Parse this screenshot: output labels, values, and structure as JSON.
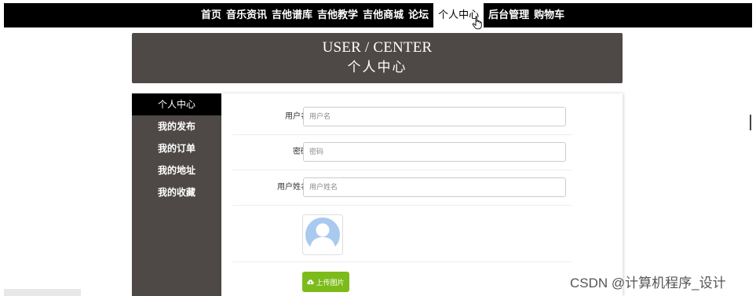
{
  "nav": {
    "items": [
      {
        "label": "首页"
      },
      {
        "label": "音乐资讯"
      },
      {
        "label": "吉他谱库"
      },
      {
        "label": "吉他教学"
      },
      {
        "label": "吉他商城"
      },
      {
        "label": "论坛"
      },
      {
        "label": "个人中心",
        "active": true
      },
      {
        "label": "后台管理"
      },
      {
        "label": "购物车"
      }
    ]
  },
  "banner": {
    "title_en": "USER / CENTER",
    "title_cn": "个人中心"
  },
  "sidebar": {
    "items": [
      {
        "label": "个人中心",
        "active": true
      },
      {
        "label": "我的发布"
      },
      {
        "label": "我的订单"
      },
      {
        "label": "我的地址"
      },
      {
        "label": "我的收藏"
      }
    ]
  },
  "form": {
    "username": {
      "label": "用户名",
      "placeholder": "用户名",
      "value": ""
    },
    "password": {
      "label": "密码",
      "placeholder": "密码",
      "value": ""
    },
    "fullname": {
      "label": "用户姓名",
      "placeholder": "用户姓名",
      "value": ""
    },
    "upload_label": "上传图片"
  },
  "watermark": "CSDN @计算机程序_设计",
  "colors": {
    "nav_bg": "#000000",
    "banner_bg": "#4e4846",
    "sidebar_bg": "#4e4846",
    "sidebar_active_bg": "#000000",
    "upload_button": "#7cbb1a",
    "avatar_silhouette": "#a9c9ee"
  },
  "icons": {
    "cursor": "hand-pointer-icon",
    "avatar": "user-avatar-icon",
    "upload": "cloud-upload-icon"
  }
}
